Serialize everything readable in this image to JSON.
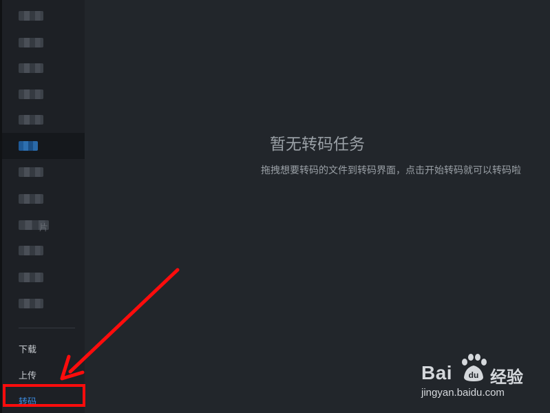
{
  "sidebar": {
    "categories": [
      {
        "id": "1"
      },
      {
        "id": "2"
      },
      {
        "id": "3"
      },
      {
        "id": "4"
      },
      {
        "id": "5"
      },
      {
        "id": "6",
        "active": true
      },
      {
        "id": "7"
      },
      {
        "id": "8"
      },
      {
        "id": "9",
        "suffix": "片"
      },
      {
        "id": "10"
      },
      {
        "id": "11"
      },
      {
        "id": "12"
      }
    ],
    "tools": [
      {
        "label": "下载"
      },
      {
        "label": "上传"
      },
      {
        "label": "转码",
        "active": true
      }
    ]
  },
  "main": {
    "empty_title": "暂无转码任务",
    "empty_description": "拖拽想要转码的文件到转码界面，点击开始转码就可以转码啦"
  },
  "watermark": {
    "brand": "Bai",
    "brand_suffix": "du",
    "product": "经验",
    "url": "jingyan.baidu.com"
  },
  "colors": {
    "accent": "#3d8ee6",
    "annotation_red": "#ff0c0c",
    "sidebar_bg": "#1d2025",
    "main_bg": "#22262b"
  }
}
